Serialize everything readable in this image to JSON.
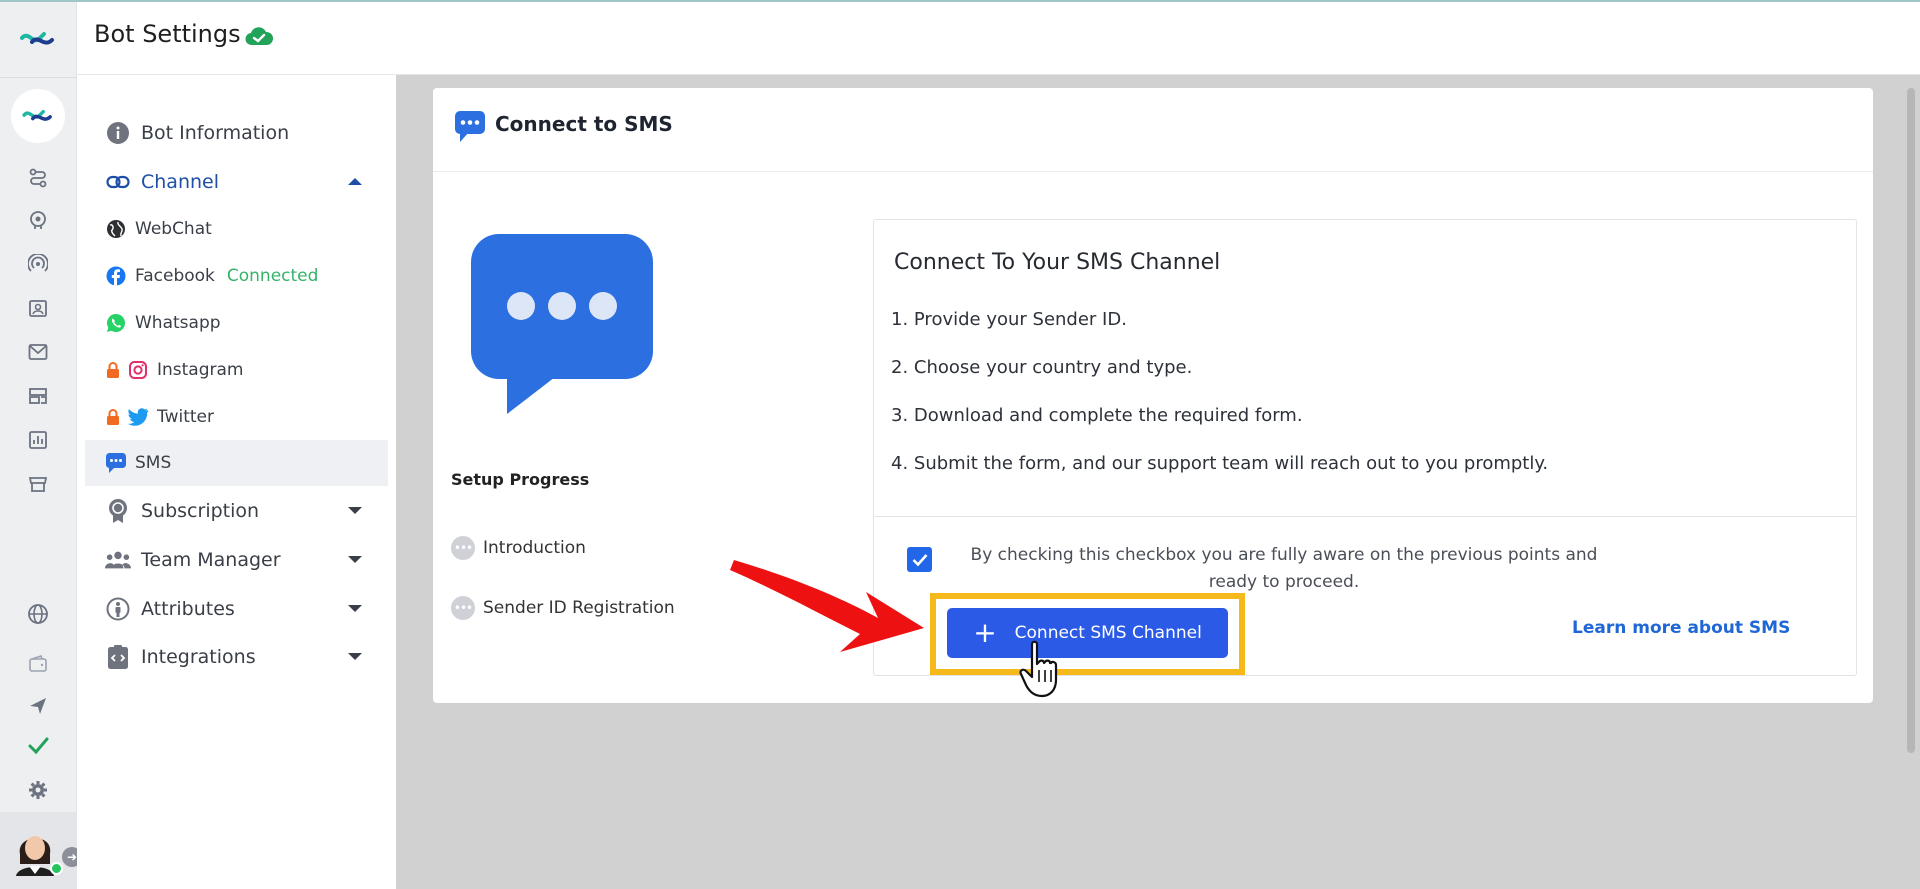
{
  "header": {
    "title": "Bot Settings"
  },
  "menu": {
    "bot_information": "Bot Information",
    "channel": "Channel",
    "channels": {
      "webchat": "WebChat",
      "facebook": "Facebook",
      "facebook_status": "Connected",
      "whatsapp": "Whatsapp",
      "instagram": "Instagram",
      "twitter": "Twitter",
      "sms": "SMS"
    },
    "subscription": "Subscription",
    "team_manager": "Team Manager",
    "attributes": "Attributes",
    "integrations": "Integrations"
  },
  "card": {
    "title": "Connect to SMS",
    "setup_progress": "Setup Progress",
    "steps": [
      "Introduction",
      "Sender ID Registration"
    ],
    "info_title": "Connect To Your SMS Channel",
    "instructions": [
      "1. Provide your Sender ID.",
      "2. Choose your country and type.",
      "3. Download and complete the required form.",
      "4. Submit the form, and our support team will reach out to you promptly."
    ],
    "checkbox_text": "By checking this checkbox you are fully aware on the previous points and ready to proceed.",
    "checkbox_checked": true,
    "connect_button": "Connect SMS Channel",
    "learn_more": "Learn more about SMS"
  },
  "colors": {
    "accent": "#2b5ae6",
    "active_menu": "#1e4fa8",
    "connected": "#34b36a",
    "highlight": "#f5b91c",
    "annotation_arrow": "#ee1111"
  }
}
